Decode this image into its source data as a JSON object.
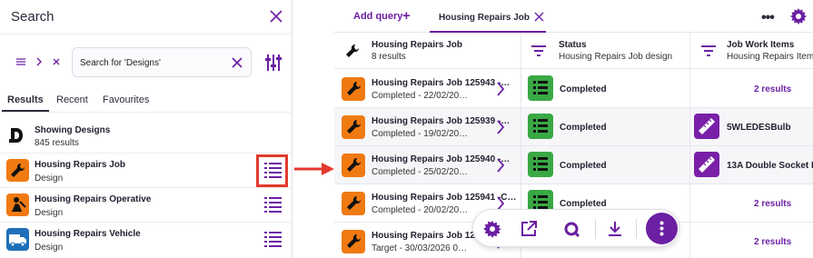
{
  "search_panel": {
    "title": "Search",
    "search_value": "Search for 'Designs'",
    "tabs": [
      "Results",
      "Recent",
      "Favourites"
    ],
    "showing_title": "Showing Designs",
    "showing_count": "845 results",
    "results": [
      {
        "name": "Housing Repairs Job",
        "type": "Design"
      },
      {
        "name": "Housing Repairs Operative",
        "type": "Design"
      },
      {
        "name": "Housing Repairs Vehicle",
        "type": "Design"
      }
    ]
  },
  "query_view": {
    "add_query_label": "Add query",
    "tab_label": "Housing Repairs Job",
    "columns": [
      {
        "title": "Housing Repairs Job",
        "subtitle": "8 results"
      },
      {
        "title": "Status",
        "subtitle": "Housing Repairs Job design"
      },
      {
        "title": "Job Work Items",
        "subtitle": "Housing Repairs Item"
      }
    ],
    "rows": [
      {
        "title": "Housing Repairs Job 125943 -…",
        "subtitle": "Completed - 22/02/20…",
        "status": "Completed",
        "work": "2 results"
      },
      {
        "title": "Housing Repairs Job 125939 -…",
        "subtitle": "Completed - 19/02/20…",
        "status": "Completed",
        "work": "5WLEDESBulb"
      },
      {
        "title": "Housing Repairs Job 125940 -…",
        "subtitle": "Completed - 25/02/20…",
        "status": "Completed",
        "work": "13A Double Socket F"
      },
      {
        "title": "Housing Repairs Job 125941 -C…",
        "subtitle": "Completed - 20/02/20…",
        "status": "Completed",
        "work": "2 results"
      },
      {
        "title": "Housing Repairs Job 125942 -…",
        "subtitle": "Target - 30/03/2026 0…",
        "status": "",
        "work": "2 results"
      }
    ]
  },
  "colors": {
    "accent": "#6b1fa3",
    "orange": "#f07a12",
    "green": "#39a845",
    "highlight": "#e33a2e"
  }
}
